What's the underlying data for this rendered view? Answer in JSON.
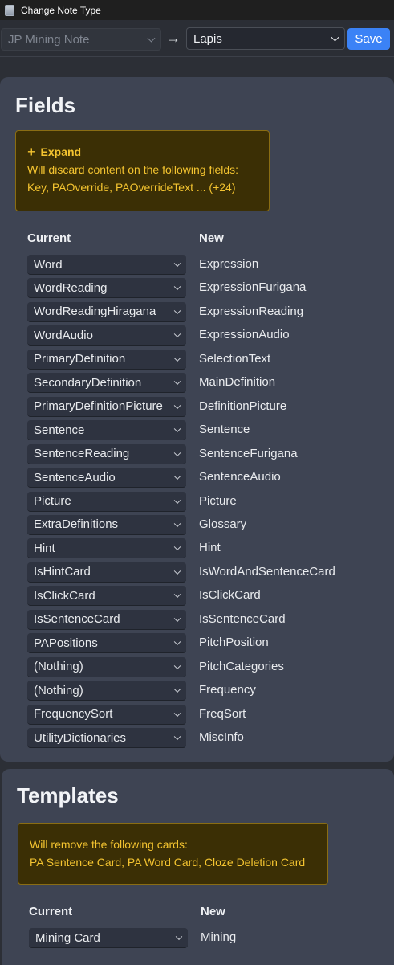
{
  "window": {
    "title": "Change Note Type"
  },
  "topbar": {
    "from_type": "JP Mining Note",
    "arrow": "→",
    "to_type": "Lapis",
    "save_label": "Save"
  },
  "fields": {
    "heading": "Fields",
    "warning": {
      "expand_label": "Expand",
      "line1": "Will discard content on the following fields:",
      "line2": "Key, PAOverride, PAOverrideText ... (+24)"
    },
    "current_header": "Current",
    "new_header": "New",
    "rows": [
      {
        "current": "Word",
        "new": "Expression"
      },
      {
        "current": "WordReading",
        "new": "ExpressionFurigana"
      },
      {
        "current": "WordReadingHiragana",
        "new": "ExpressionReading"
      },
      {
        "current": "WordAudio",
        "new": "ExpressionAudio"
      },
      {
        "current": "PrimaryDefinition",
        "new": "SelectionText"
      },
      {
        "current": "SecondaryDefinition",
        "new": "MainDefinition"
      },
      {
        "current": "PrimaryDefinitionPicture",
        "new": "DefinitionPicture"
      },
      {
        "current": "Sentence",
        "new": "Sentence"
      },
      {
        "current": "SentenceReading",
        "new": "SentenceFurigana"
      },
      {
        "current": "SentenceAudio",
        "new": "SentenceAudio"
      },
      {
        "current": "Picture",
        "new": "Picture"
      },
      {
        "current": "ExtraDefinitions",
        "new": "Glossary"
      },
      {
        "current": "Hint",
        "new": "Hint"
      },
      {
        "current": "IsHintCard",
        "new": "IsWordAndSentenceCard"
      },
      {
        "current": "IsClickCard",
        "new": "IsClickCard"
      },
      {
        "current": "IsSentenceCard",
        "new": "IsSentenceCard"
      },
      {
        "current": "PAPositions",
        "new": "PitchPosition"
      },
      {
        "current": "(Nothing)",
        "new": "PitchCategories"
      },
      {
        "current": "(Nothing)",
        "new": "Frequency"
      },
      {
        "current": "FrequencySort",
        "new": "FreqSort"
      },
      {
        "current": "UtilityDictionaries",
        "new": "MiscInfo"
      }
    ]
  },
  "templates": {
    "heading": "Templates",
    "warning": {
      "line1": "Will remove the following cards:",
      "line2": "PA Sentence Card, PA Word Card, Cloze Deletion Card"
    },
    "current_header": "Current",
    "new_header": "New",
    "rows": [
      {
        "current": "Mining Card",
        "new": "Mining"
      }
    ]
  },
  "colors": {
    "background": "#2c2f36",
    "panel": "#3e4453",
    "select": "#2e3340",
    "accent": "#3b82f6",
    "warning_bg": "#3b2f05",
    "warning_text": "#f4c430"
  }
}
